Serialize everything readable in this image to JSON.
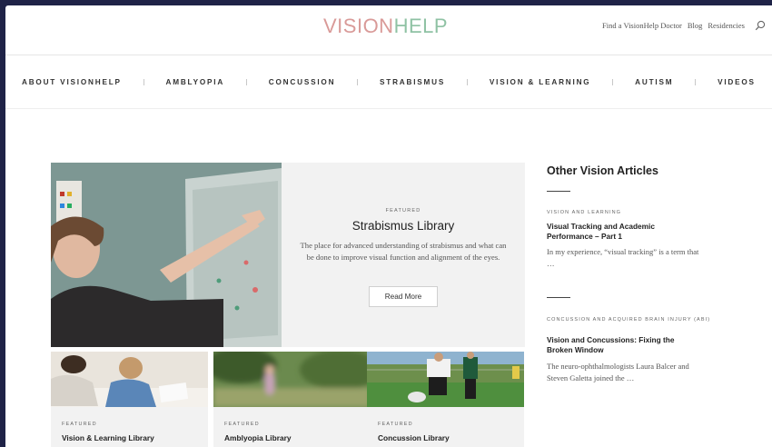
{
  "header": {
    "logo_part1": "VISION",
    "logo_part2": "HELP",
    "links": [
      "Find a VisionHelp Doctor",
      "Blog",
      "Residencies"
    ]
  },
  "nav": {
    "items": [
      "ABOUT VISIONHELP",
      "AMBLYOPIA",
      "CONCUSSION",
      "STRABISMUS",
      "VISION & LEARNING",
      "AUTISM",
      "VIDEOS"
    ]
  },
  "hero": {
    "kicker": "FEATURED",
    "title": "Strabismus Library",
    "description": "The place for advanced understanding of strabismus and what can be done to improve visual function and alignment of the eyes.",
    "button": "Read More"
  },
  "cards": [
    {
      "kicker": "FEATURED",
      "title": "Vision & Learning Library"
    },
    {
      "kicker": "FEATURED",
      "title": "Amblyopia Library"
    },
    {
      "kicker": "FEATURED",
      "title": "Concussion Library"
    }
  ],
  "sidebar": {
    "title": "Other Vision Articles",
    "articles": [
      {
        "category": "VISION AND LEARNING",
        "title": "Visual Tracking and Academic Performance – Part 1",
        "excerpt": "In my experience, “visual tracking” is a term that …"
      },
      {
        "category": "CONCUSSION AND ACQUIRED BRAIN INJURY (ABI)",
        "title": "Vision and Concussions: Fixing the Broken Window",
        "excerpt": "The neuro-ophthalmologists Laura Balcer and Steven Galetta joined the …"
      }
    ]
  },
  "colors": {
    "logo_pink": "#d99a98",
    "logo_green": "#8fc2a4",
    "frame_background": "#1f2347"
  },
  "icons": {
    "search": "search-icon"
  }
}
